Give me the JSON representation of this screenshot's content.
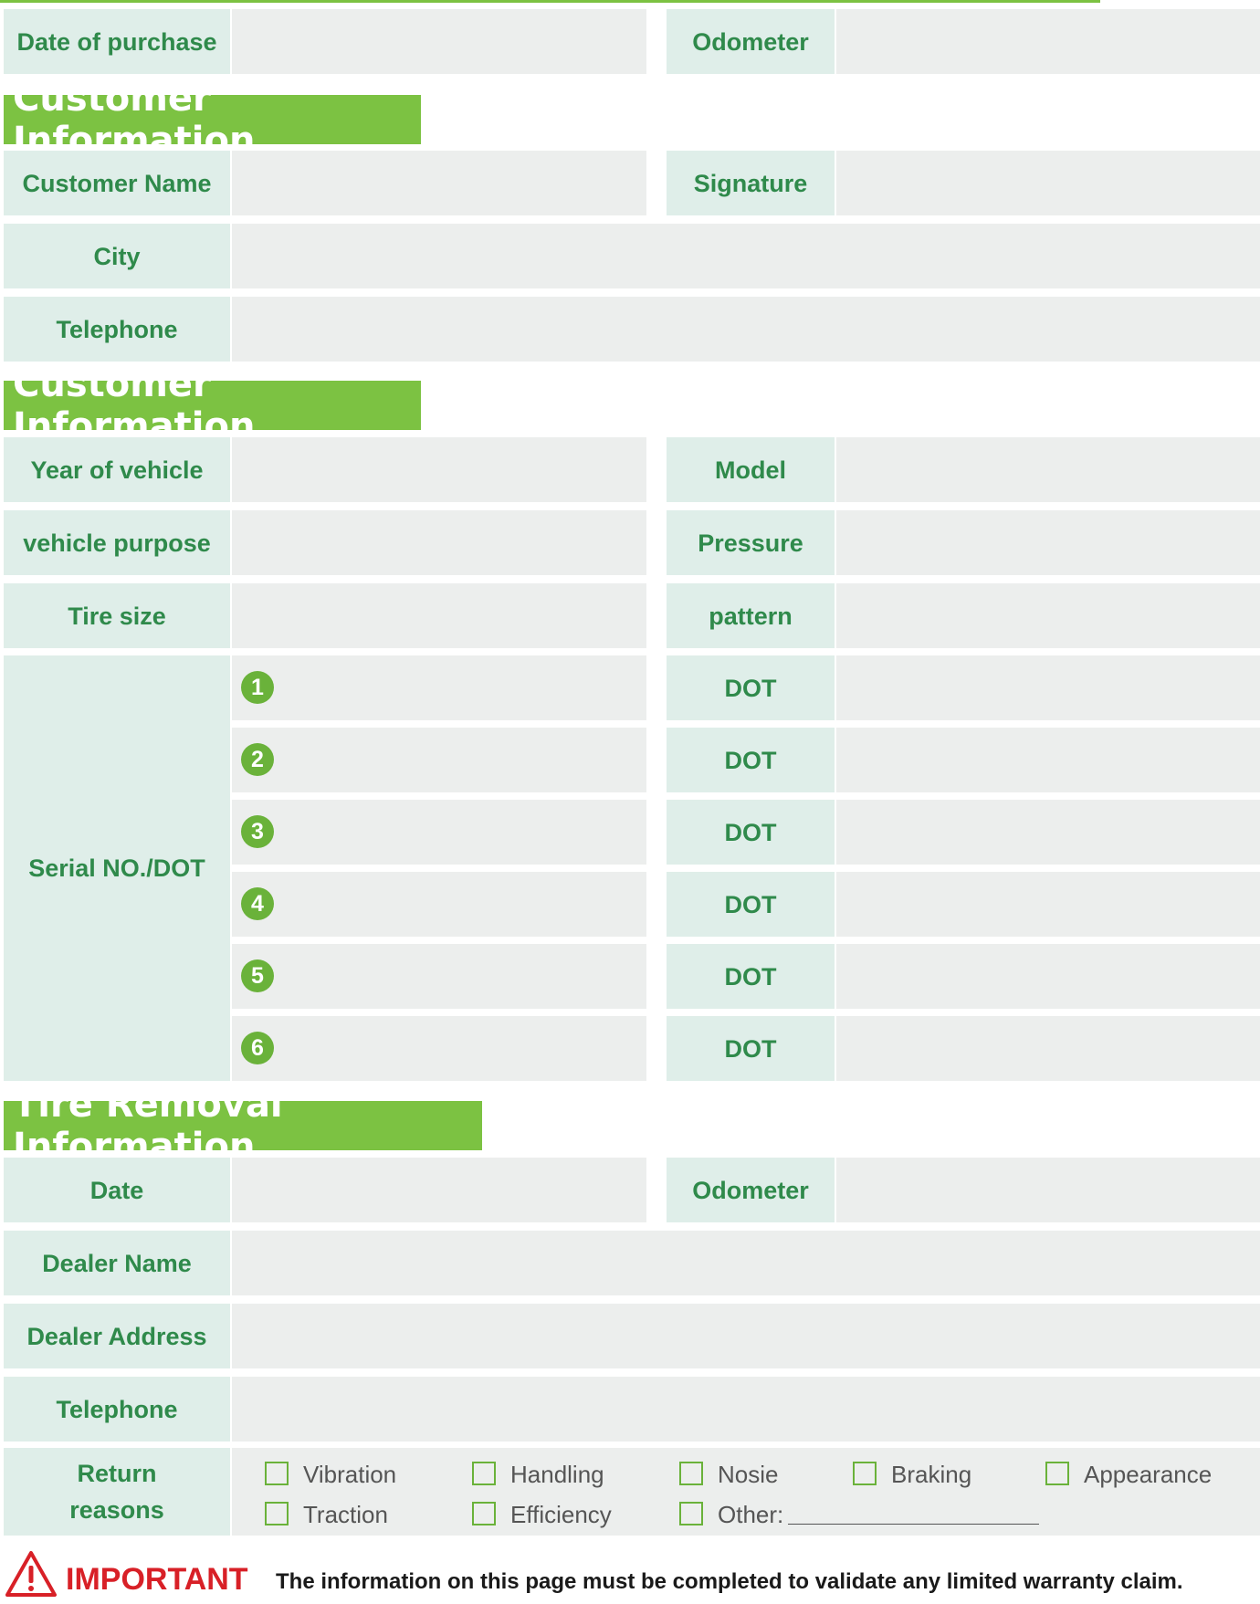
{
  "purchase": {
    "date_label": "Date of purchase",
    "odometer_label": "Odometer"
  },
  "customer": {
    "title": "Customer Information",
    "name_label": "Customer Name",
    "signature_label": "Signature",
    "city_label": "City",
    "telephone_label": "Telephone"
  },
  "vehicle": {
    "title": "Customer Information",
    "year_label": "Year of vehicle",
    "model_label": "Model",
    "purpose_label": "vehicle purpose",
    "pressure_label": "Pressure",
    "tire_size_label": "Tire size",
    "pattern_label": "pattern",
    "serial_label": "Serial NO./DOT",
    "serial_numbers": [
      "1",
      "2",
      "3",
      "4",
      "5",
      "6"
    ],
    "dot_label": "DOT"
  },
  "removal": {
    "title": "Tire Removal Information",
    "date_label": "Date",
    "odometer_label": "Odometer",
    "dealer_name_label": "Dealer Name",
    "dealer_address_label": "Dealer Address",
    "telephone_label": "Telephone",
    "return_reasons_label_line1": "Return",
    "return_reasons_label_line2": "reasons",
    "reasons": [
      "Vibration",
      "Handling",
      "Nosie",
      "Braking",
      "Appearance",
      "Traction",
      "Efficiency",
      "Other:"
    ]
  },
  "notice": {
    "important": "IMPORTANT",
    "message": "The information on this page must be completed to validate any limited warranty claim.",
    "icon": "warning-triangle-icon",
    "accent_color": "#d82027"
  },
  "colors": {
    "brand_green": "#7cc242",
    "label_text": "#2f8a4b",
    "label_bg": "#dfeee9",
    "field_bg": "#eceeed"
  }
}
